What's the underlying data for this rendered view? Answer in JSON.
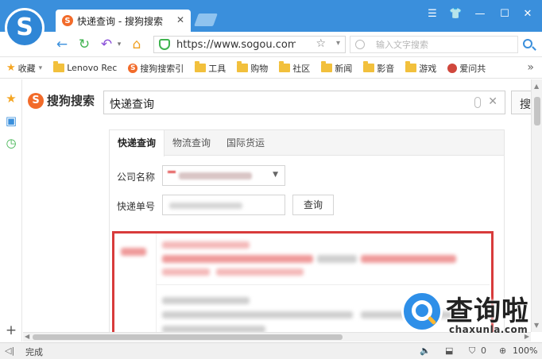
{
  "browser": {
    "tab_title": "快递查询 - 搜狗搜索",
    "url": "https://www.sogou.com/we",
    "search_placeholder": "输入文字搜索"
  },
  "bookmarks": {
    "items": [
      {
        "label": "收藏",
        "icon": "star-icon"
      },
      {
        "label": "Lenovo Rec",
        "icon": "folder-icon"
      },
      {
        "label": "搜狗搜索引",
        "icon": "sogou-icon"
      },
      {
        "label": "工具",
        "icon": "folder-icon"
      },
      {
        "label": "购物",
        "icon": "folder-icon"
      },
      {
        "label": "社区",
        "icon": "folder-icon"
      },
      {
        "label": "新闻",
        "icon": "folder-icon"
      },
      {
        "label": "影音",
        "icon": "folder-icon"
      },
      {
        "label": "游戏",
        "icon": "folder-icon"
      },
      {
        "label": "爱问共",
        "icon": "person-icon"
      }
    ]
  },
  "search": {
    "logo_text": "搜狗搜索",
    "query": "快递查询",
    "button_label": "搜"
  },
  "widget": {
    "tabs": [
      "快递查询",
      "物流查询",
      "国际货运"
    ],
    "company_label": "公司名称",
    "number_label": "快递单号",
    "query_button": "查询"
  },
  "status": {
    "text": "完成",
    "security_count": "0",
    "zoom": "100%"
  },
  "watermark": {
    "main": "查询啦",
    "sub": "chaxunla.com"
  },
  "colors": {
    "titlebar": "#3a8fdc",
    "highlight_border": "#d83b3b",
    "sogou_orange": "#f26b2a"
  }
}
